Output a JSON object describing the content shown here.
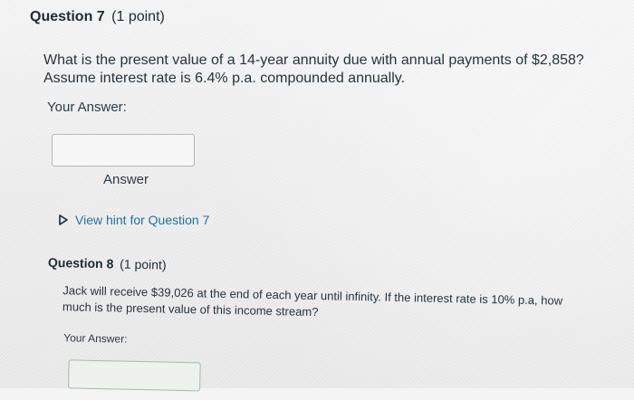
{
  "question7": {
    "number": "Question 7",
    "points": "(1 point)",
    "text": "What is the present value of a 14-year annuity due with annual payments of $2,858? Assume interest rate is 6.4% p.a. compounded annually.",
    "your_answer_label": "Your Answer:",
    "answer_value": "",
    "answer_label": "Answer",
    "hint_link": "View hint for Question 7",
    "hint_icon": "triangle-right-icon"
  },
  "question8": {
    "number": "Question 8",
    "points": "(1 point)",
    "text": "Jack will receive $39,026 at the end of each year until infinity. If the interest rate is 10% p.a, how much is the present value of this income stream?",
    "your_answer_label": "Your Answer:",
    "answer_value": ""
  },
  "colors": {
    "link": "#2470a7",
    "text": "#2d3b45",
    "input_border": "#b3b9bd"
  }
}
